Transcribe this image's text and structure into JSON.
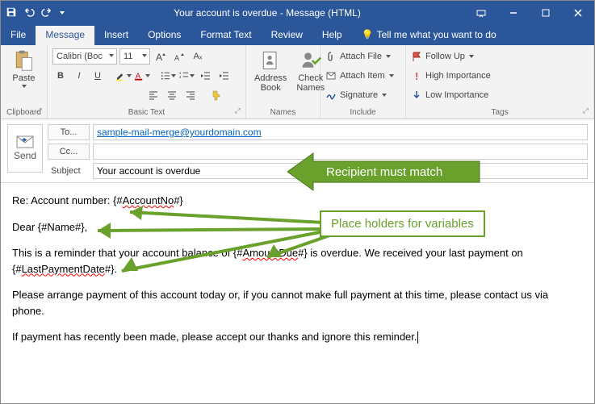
{
  "titlebar": {
    "title": "Your account is overdue  -  Message (HTML)"
  },
  "tabs": [
    "File",
    "Message",
    "Insert",
    "Options",
    "Format Text",
    "Review",
    "Help"
  ],
  "tellme": "Tell me what you want to do",
  "ribbon": {
    "paste": "Paste",
    "clipboard": "Clipboard",
    "font": "Calibri (Boc",
    "size": "11",
    "basictext": "Basic Text",
    "address": "Address\nBook",
    "check": "Check\nNames",
    "names": "Names",
    "attachfile": "Attach File",
    "attachitem": "Attach Item",
    "signature": "Signature",
    "include": "Include",
    "followup": "Follow Up",
    "high": "High Importance",
    "low": "Low Importance",
    "tags": "Tags"
  },
  "fields": {
    "send": "Send",
    "to": "To...",
    "cc": "Cc...",
    "subject_label": "Subject",
    "to_value": "sample-mail-merge@yourdomain.com",
    "cc_value": "",
    "subject_value": "Your account is overdue"
  },
  "body": {
    "p1a": "Re: Account number: {#",
    "p1b": "AccountNo",
    "p1c": "#}",
    "p2a": "Dear {#Name#},",
    "p3a": "This is a reminder that your account balance of {#",
    "p3b": "AmountDue",
    "p3c": "#} is overdue. We received your last payment on {#",
    "p3d": "LastPaymentDate",
    "p3e": "#}.",
    "p4": "Please arrange payment of this account today or, if you cannot make full payment at this time, please contact us via phone.",
    "p5": "If payment has recently been made, please accept our thanks and ignore this reminder."
  },
  "callouts": {
    "c1": "Recipient must match",
    "c2": "Place holders for variables"
  }
}
